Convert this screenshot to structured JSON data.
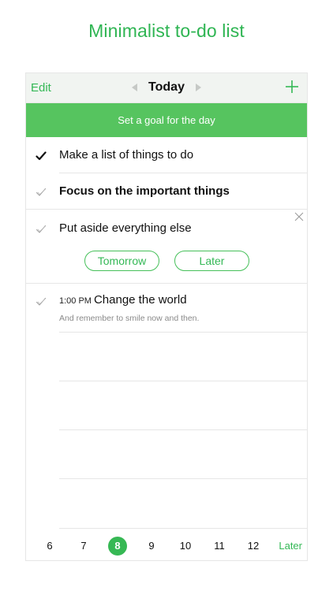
{
  "headline": "Minimalist to-do list",
  "navbar": {
    "edit_label": "Edit",
    "title": "Today"
  },
  "goal_bar": {
    "label": "Set a goal for the day"
  },
  "tasks": [
    {
      "text": "Make a list of things to do",
      "done": true
    },
    {
      "text": "Focus on the important things",
      "bold": true
    },
    {
      "text": "Put aside everything else",
      "actions": [
        "Tomorrow",
        "Later"
      ]
    },
    {
      "time": "1:00 PM",
      "text": "Change the world",
      "note": "And remember to smile now and then."
    }
  ],
  "daybar": {
    "days": [
      "6",
      "7",
      "8",
      "9",
      "10",
      "11",
      "12"
    ],
    "selected": "8",
    "later_label": "Later"
  },
  "colors": {
    "accent": "#34b856",
    "goal_bar": "#56c45f",
    "navbar_bg": "#f1f4f1"
  }
}
